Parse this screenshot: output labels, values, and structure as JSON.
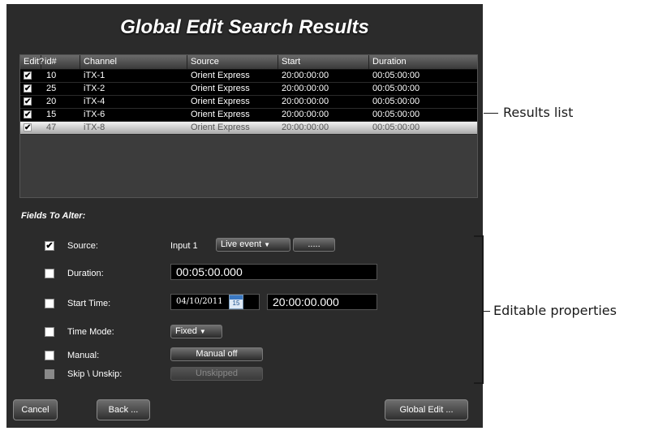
{
  "window": {
    "title": "Global Edit Search Results"
  },
  "grid": {
    "headers": [
      "Edit?",
      "id#",
      "Channel",
      "Source",
      "Start",
      "Duration"
    ],
    "rows": [
      {
        "id": "10",
        "channel": "iTX-1",
        "source": "Orient Express",
        "start": "20:00:00:00",
        "duration": "00:05:00:00",
        "checked": true,
        "selected": false
      },
      {
        "id": "25",
        "channel": "iTX-2",
        "source": "Orient Express",
        "start": "20:00:00:00",
        "duration": "00:05:00:00",
        "checked": true,
        "selected": false
      },
      {
        "id": "20",
        "channel": "iTX-4",
        "source": "Orient Express",
        "start": "20:00:00:00",
        "duration": "00:05:00:00",
        "checked": true,
        "selected": false
      },
      {
        "id": "15",
        "channel": "iTX-6",
        "source": "Orient Express",
        "start": "20:00:00:00",
        "duration": "00:05:00:00",
        "checked": true,
        "selected": false
      },
      {
        "id": "47",
        "channel": "iTX-8",
        "source": "Orient Express",
        "start": "20:00:00:00",
        "duration": "00:05:00:00",
        "checked": true,
        "selected": true
      }
    ]
  },
  "fields": {
    "title": "Fields To Alter:",
    "source": {
      "label": "Source:",
      "checked": true,
      "input_label": "Input 1",
      "dropdown": "Live event",
      "browse": "....."
    },
    "duration": {
      "label": "Duration:",
      "checked": false,
      "value": "00:05:00.000"
    },
    "start_time": {
      "label": "Start Time:",
      "checked": false,
      "date": "04/10/2011",
      "calendar_day": "15",
      "time": "20:00:00.000"
    },
    "time_mode": {
      "label": "Time Mode:",
      "checked": false,
      "dropdown": "Fixed"
    },
    "manual": {
      "label": "Manual:",
      "checked": false,
      "button": "Manual off"
    },
    "skip": {
      "label": "Skip \\ Unskip:",
      "checked": false,
      "button": "Unskipped"
    }
  },
  "footer": {
    "cancel": "Cancel",
    "back": "Back ...",
    "global_edit": "Global Edit ..."
  },
  "annotations": {
    "results": "Results list",
    "properties": "Editable properties"
  },
  "icons": {
    "checkmark": "✔",
    "dropdown": "▼"
  }
}
